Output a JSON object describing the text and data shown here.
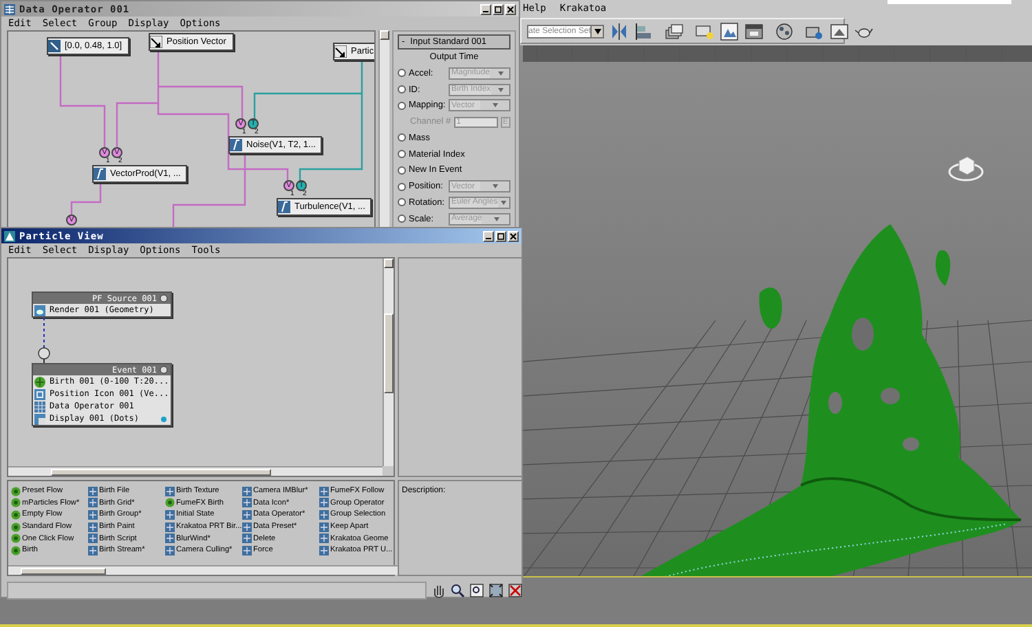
{
  "max": {
    "menu": [
      "Help",
      "Krakatoa"
    ],
    "selection_set": "ate Selection Set"
  },
  "data_operator": {
    "title": "Data Operator 001",
    "menu": [
      "Edit",
      "Select",
      "Group",
      "Display",
      "Options"
    ],
    "nodes": [
      {
        "label": "[0.0, 0.48, 1.0]",
        "kind": "constant"
      },
      {
        "label": "Position Vector",
        "kind": "input"
      },
      {
        "label": "Partic",
        "kind": "input"
      },
      {
        "label": "Noise(V1, T2, 1...",
        "kind": "function",
        "inputs": [
          {
            "symbol": "V",
            "number": "1",
            "color": "#e08ae0"
          },
          {
            "symbol": "T",
            "number": "2",
            "color": "#26b0b0"
          }
        ]
      },
      {
        "label": "VectorProd(V1, ...",
        "kind": "function",
        "inputs": [
          {
            "symbol": "V",
            "number": "1",
            "color": "#e08ae0"
          },
          {
            "symbol": "V",
            "number": "2",
            "color": "#e08ae0"
          }
        ]
      },
      {
        "label": "Turbulence(V1, ...",
        "kind": "function",
        "inputs": [
          {
            "symbol": "V",
            "number": "1",
            "color": "#e08ae0"
          },
          {
            "symbol": "T",
            "number": "2",
            "color": "#26b0b0"
          }
        ]
      }
    ],
    "loose_ports": [
      {
        "symbol": "V",
        "color": "#e08ae0"
      }
    ],
    "panel": {
      "collapse": "-",
      "title": "Input Standard 001",
      "subtitle": "Output Time",
      "options": [
        {
          "kind": "radio",
          "label": "Accel:",
          "selected": false,
          "value": "Magnitude",
          "disabled": true
        },
        {
          "kind": "radio",
          "label": "ID:",
          "selected": false,
          "value": "Birth Index",
          "disabled": true
        },
        {
          "kind": "radio",
          "label": "Mapping:",
          "selected": false,
          "value": "Vector",
          "disabled": true
        },
        {
          "kind": "channel",
          "label": "Channel #",
          "value": "1",
          "button": "E",
          "disabled": true
        },
        {
          "kind": "radio",
          "label": "Mass",
          "selected": false
        },
        {
          "kind": "radio",
          "label": "Material Index",
          "selected": false
        },
        {
          "kind": "radio",
          "label": "New In Event",
          "selected": false
        },
        {
          "kind": "radio",
          "label": "Position:",
          "selected": false,
          "value": "Vector",
          "disabled": true
        },
        {
          "kind": "radio",
          "label": "Rotation:",
          "selected": false,
          "value": "Euler Angles",
          "disabled": true
        },
        {
          "kind": "radio",
          "label": "Scale:",
          "selected": false,
          "value": "Average",
          "disabled": true
        }
      ]
    }
  },
  "particle_view": {
    "title": "Particle View",
    "menu": [
      "Edit",
      "Select",
      "Display",
      "Options",
      "Tools"
    ],
    "source": {
      "title": "PF Source 001",
      "operators": [
        {
          "label": "Render 001 (Geometry)",
          "kind": "render"
        }
      ]
    },
    "event": {
      "title": "Event 001",
      "operators": [
        {
          "label": "Birth 001 (0-100 T:20...",
          "kind": "birth"
        },
        {
          "label": "Position Icon 001 (Ve...",
          "kind": "position"
        },
        {
          "label": "Data Operator 001",
          "kind": "data"
        },
        {
          "label": "Display 001 (Dots)",
          "kind": "display",
          "color": "#1fa3c9"
        }
      ]
    },
    "depot": [
      [
        {
          "label": "Preset Flow",
          "kind": "flow"
        },
        {
          "label": "mParticles Flow*",
          "kind": "flow"
        },
        {
          "label": "Empty Flow",
          "kind": "flow"
        },
        {
          "label": "Standard Flow",
          "kind": "flow"
        },
        {
          "label": "One Click Flow",
          "kind": "flow"
        },
        {
          "label": "Birth",
          "kind": "flow"
        }
      ],
      [
        {
          "label": "Birth File",
          "kind": "operator"
        },
        {
          "label": "Birth Grid*",
          "kind": "operator"
        },
        {
          "label": "Birth Group*",
          "kind": "operator"
        },
        {
          "label": "Birth Paint",
          "kind": "operator"
        },
        {
          "label": "Birth Script",
          "kind": "operator"
        },
        {
          "label": "Birth Stream*",
          "kind": "operator"
        }
      ],
      [
        {
          "label": "Birth Texture",
          "kind": "operator"
        },
        {
          "label": "FumeFX Birth",
          "kind": "flow"
        },
        {
          "label": "Initial State",
          "kind": "operator"
        },
        {
          "label": "Krakatoa PRT Bir...",
          "kind": "operator"
        },
        {
          "label": "BlurWind*",
          "kind": "operator"
        },
        {
          "label": "Camera Culling*",
          "kind": "operator"
        }
      ],
      [
        {
          "label": "Camera IMBlur*",
          "kind": "operator"
        },
        {
          "label": "Data Icon*",
          "kind": "operator"
        },
        {
          "label": "Data Operator*",
          "kind": "operator"
        },
        {
          "label": "Data Preset*",
          "kind": "operator"
        },
        {
          "label": "Delete",
          "kind": "operator"
        },
        {
          "label": "Force",
          "kind": "operator"
        }
      ],
      [
        {
          "label": "FumeFX Follow",
          "kind": "operator"
        },
        {
          "label": "Group Operator",
          "kind": "operator"
        },
        {
          "label": "Group Selection",
          "kind": "operator"
        },
        {
          "label": "Keep Apart",
          "kind": "operator"
        },
        {
          "label": "Krakatoa Geome",
          "kind": "operator"
        },
        {
          "label": "Krakatoa PRT U...",
          "kind": "operator"
        }
      ]
    ],
    "description_label": "Description:"
  }
}
